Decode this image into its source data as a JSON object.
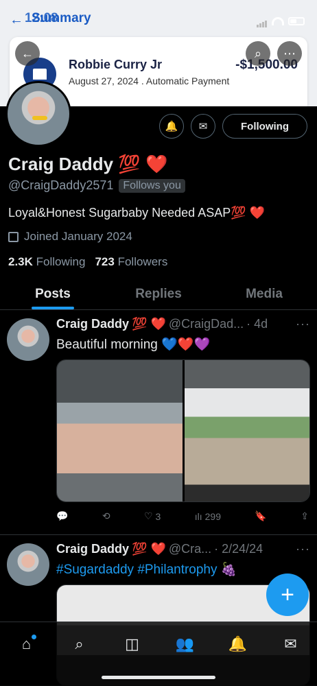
{
  "overlay": {
    "time": "12:08",
    "back_label": "Summary",
    "payee": "Robbie Curry Jr",
    "details": "August 27, 2024 . Automatic Payment",
    "amount": "-$1,500.00"
  },
  "profile": {
    "name": "Craig Daddy",
    "name_emoji": "💯 ❤️",
    "handle": "@CraigDaddy2571",
    "follows_you": "Follows you",
    "bio": "Loyal&Honest Sugarbaby Needed ASAP💯 ❤️",
    "joined": "Joined January 2024",
    "following_count": "2.3K",
    "following_label": "Following",
    "followers_count": "723",
    "followers_label": "Followers",
    "follow_button": "Following"
  },
  "tabs": [
    "Posts",
    "Replies",
    "Media"
  ],
  "tweets": [
    {
      "name": "Craig Daddy",
      "emoji": "💯 ❤️",
      "handle": "@CraigDad...",
      "time": "· 4d",
      "text": "Beautiful morning 💙❤️💜",
      "likes": "3",
      "views": "299"
    },
    {
      "name": "Craig Daddy",
      "emoji": "💯 ❤️",
      "handle": "@Cra...",
      "time": "· 2/24/24",
      "text": "#Sugardaddy #Philantrophy 🍇"
    }
  ],
  "icons": {
    "back": "arrow-left-icon",
    "search": "search-icon",
    "more": "more-icon",
    "notify": "bell-plus-icon",
    "message": "envelope-icon",
    "calendar": "calendar-icon",
    "compose": "plus-icon"
  },
  "colors": {
    "accent": "#1d9bf0",
    "bg": "#000000",
    "muted": "#71767b"
  }
}
